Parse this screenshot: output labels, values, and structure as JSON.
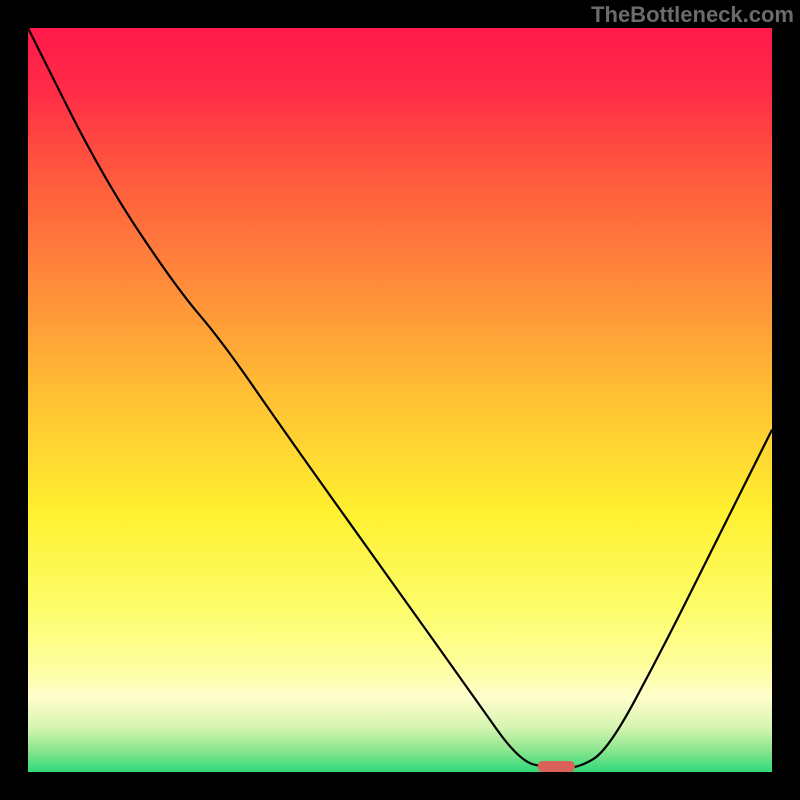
{
  "watermark": "TheBottleneck.com",
  "chart_data": {
    "type": "line",
    "title": "",
    "xlabel": "",
    "ylabel": "",
    "xlim": [
      0,
      100
    ],
    "ylim": [
      0,
      100
    ],
    "background_gradient": {
      "stops": [
        {
          "pos": 0.0,
          "color": "#ff1a4a"
        },
        {
          "pos": 0.08,
          "color": "#ff2a47"
        },
        {
          "pos": 0.2,
          "color": "#ff5a3e"
        },
        {
          "pos": 0.35,
          "color": "#ff8d3a"
        },
        {
          "pos": 0.5,
          "color": "#ffc233"
        },
        {
          "pos": 0.65,
          "color": "#fff030"
        },
        {
          "pos": 0.78,
          "color": "#fdfd6a"
        },
        {
          "pos": 0.86,
          "color": "#feffa0"
        },
        {
          "pos": 0.9,
          "color": "#fffecd"
        },
        {
          "pos": 0.94,
          "color": "#d6f5b0"
        },
        {
          "pos": 0.97,
          "color": "#8de68e"
        },
        {
          "pos": 1.0,
          "color": "#2fd97a"
        }
      ]
    },
    "curve": [
      {
        "x": 0,
        "y": 100
      },
      {
        "x": 10,
        "y": 80
      },
      {
        "x": 20,
        "y": 65
      },
      {
        "x": 26,
        "y": 58
      },
      {
        "x": 35,
        "y": 45
      },
      {
        "x": 50,
        "y": 24
      },
      {
        "x": 60,
        "y": 10
      },
      {
        "x": 66,
        "y": 1.5
      },
      {
        "x": 70,
        "y": 0.5
      },
      {
        "x": 74,
        "y": 0.5
      },
      {
        "x": 78,
        "y": 3
      },
      {
        "x": 85,
        "y": 16
      },
      {
        "x": 92,
        "y": 30
      },
      {
        "x": 100,
        "y": 46
      }
    ],
    "marker": {
      "x": 71,
      "y": 0.8,
      "width": 5,
      "color": "#d9625b"
    }
  }
}
